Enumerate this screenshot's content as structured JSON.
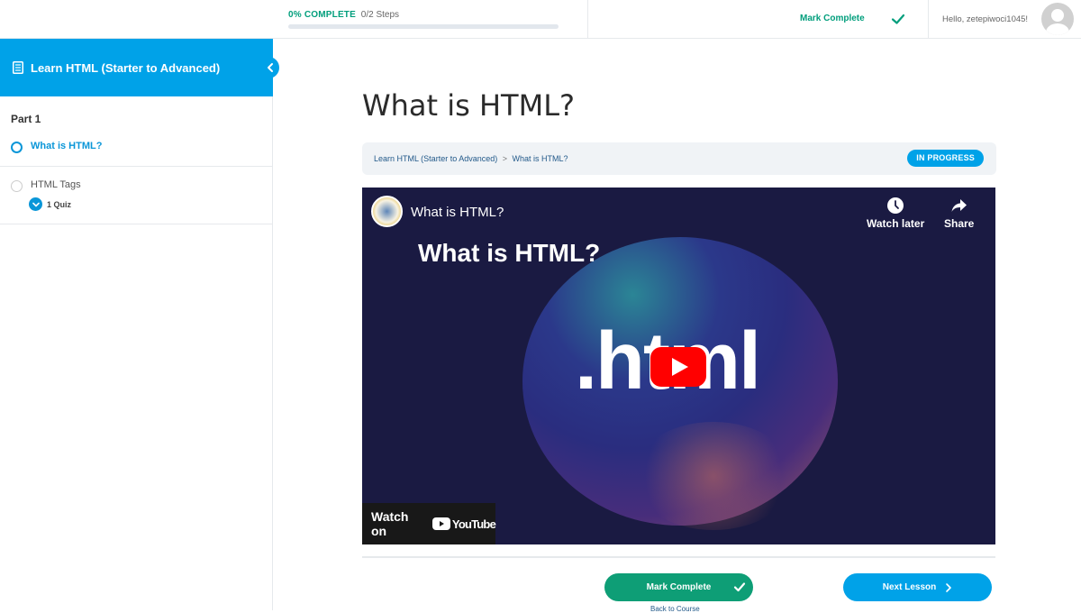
{
  "topbar": {
    "progress_percent_label": "0% COMPLETE",
    "progress_steps": "0/2 Steps",
    "progress_fraction": 0,
    "mark_complete_label": "Mark Complete",
    "greeting": "Hello, zetepiwoci1045!"
  },
  "sidebar": {
    "course_title": "Learn HTML (Starter to Advanced)",
    "section_title": "Part 1",
    "lessons": [
      {
        "label": "What is HTML?",
        "state": "current"
      },
      {
        "label": "HTML Tags",
        "state": "not-started",
        "quiz_label": "1 Quiz"
      }
    ]
  },
  "main": {
    "page_title": "What is HTML?",
    "breadcrumb": [
      {
        "label": "Learn HTML (Starter to Advanced)"
      },
      {
        "label": "What is HTML?"
      }
    ],
    "breadcrumb_separator": ">",
    "status_badge": "IN PROGRESS",
    "video": {
      "title": "What is HTML?",
      "watch_later": "Watch later",
      "share": "Share",
      "thumbnail_heading": "What is HTML?",
      "thumbnail_text": ".html",
      "watch_on": "Watch on",
      "youtube": "YouTube"
    },
    "mark_complete_label": "Mark Complete",
    "next_lesson_label": "Next Lesson",
    "back_to_course_label": "Back to Course"
  },
  "colors": {
    "accent_blue": "#00a2e8",
    "complete_green": "#0e9e76",
    "link_blue": "#235a8a",
    "youtube_red": "#ff0000"
  }
}
